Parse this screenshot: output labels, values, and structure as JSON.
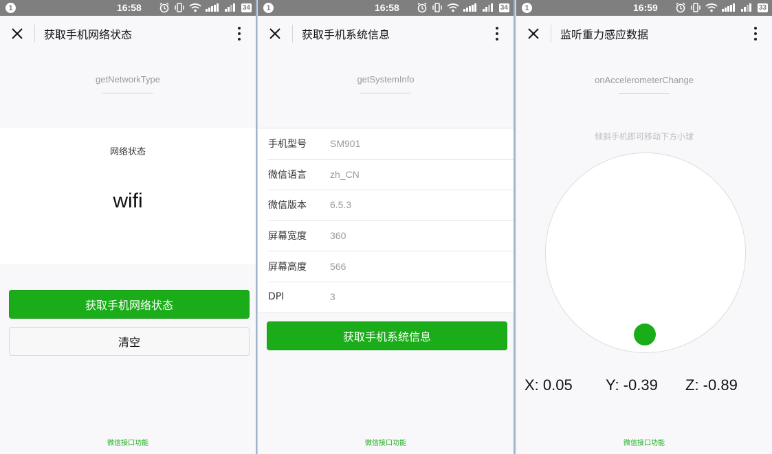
{
  "phones": [
    {
      "status": {
        "badge": "1",
        "time": "16:58",
        "battery": "34"
      },
      "nav": {
        "title": "获取手机网络状态"
      },
      "api_name": "getNetworkType",
      "network": {
        "label": "网络状态",
        "value": "wifi"
      },
      "buttons": {
        "primary": "获取手机网络状态",
        "secondary": "清空"
      },
      "footer": "微信接口功能"
    },
    {
      "status": {
        "badge": "1",
        "time": "16:58",
        "battery": "34"
      },
      "nav": {
        "title": "获取手机系统信息"
      },
      "api_name": "getSystemInfo",
      "info_rows": [
        {
          "key": "手机型号",
          "value": "SM901"
        },
        {
          "key": "微信语言",
          "value": "zh_CN"
        },
        {
          "key": "微信版本",
          "value": "6.5.3"
        },
        {
          "key": "屏幕宽度",
          "value": "360"
        },
        {
          "key": "屏幕高度",
          "value": "566"
        },
        {
          "key": "DPI",
          "value": "3"
        }
      ],
      "buttons": {
        "primary": "获取手机系统信息"
      },
      "footer": "微信接口功能"
    },
    {
      "status": {
        "badge": "1",
        "time": "16:59",
        "battery": "33"
      },
      "nav": {
        "title": "监听重力感应数据"
      },
      "api_name": "onAccelerometerChange",
      "hint": "倾斜手机即可移动下方小球",
      "accel": {
        "x": "X: 0.05",
        "y": "Y: -0.39",
        "z": "Z: -0.89"
      },
      "footer": "微信接口功能"
    }
  ],
  "colors": {
    "accent": "#1aad19",
    "statusbar": "#7f7f7f",
    "background": "#f8f8fa"
  },
  "icons": {
    "close": "close-icon",
    "more": "more-vertical-icon",
    "alarm": "alarm-icon",
    "vibrate": "vibrate-icon",
    "wifi": "wifi-icon",
    "signal": "signal-icon",
    "battery": "battery-icon"
  }
}
